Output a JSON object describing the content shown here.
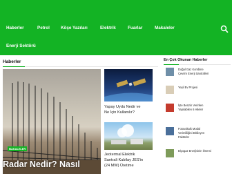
{
  "nav": {
    "items": [
      "Haberler",
      "Petrol",
      "Köşe Yazıları",
      "Elektrik",
      "Fuarlar",
      "Makaleler",
      "Enerji Sektörü"
    ],
    "search_icon": "search-icon"
  },
  "section": {
    "title": "Haberler"
  },
  "featured": {
    "badge": "MAKALELER",
    "title": "Radar Nedir? Nasıl"
  },
  "posts": [
    {
      "title_line1": "Yapay Uydu Nedir ve",
      "title_line2": "Ne İçin Kullanılır?"
    },
    {
      "title_line1": "Jeotermal Elektrik",
      "title_line2": "Santrali Kubilay JES'in",
      "title_line3": "(24 MW) Üretime"
    }
  ],
  "sidebar": {
    "title": "En Çok Okunan Haberler",
    "items": [
      {
        "line1": "Doğal Gaz Kombine",
        "line2": "Çevrim Enerji Santralleri"
      },
      {
        "line1": "Yeşil Ev Projesi",
        "line2": ""
      },
      {
        "line1": "İşte Benzin Verirken",
        "line2": "Yapılabilen 6 Hileler"
      },
      {
        "line1": "Fotovoltaik Modül",
        "line2": "Verimliliğini Etkileyen",
        "line3": "Faktörler"
      },
      {
        "line1": "Biyogaz Enerjisinin Önemi",
        "line2": ""
      }
    ]
  },
  "colors": {
    "brand_green": "#13b324"
  }
}
